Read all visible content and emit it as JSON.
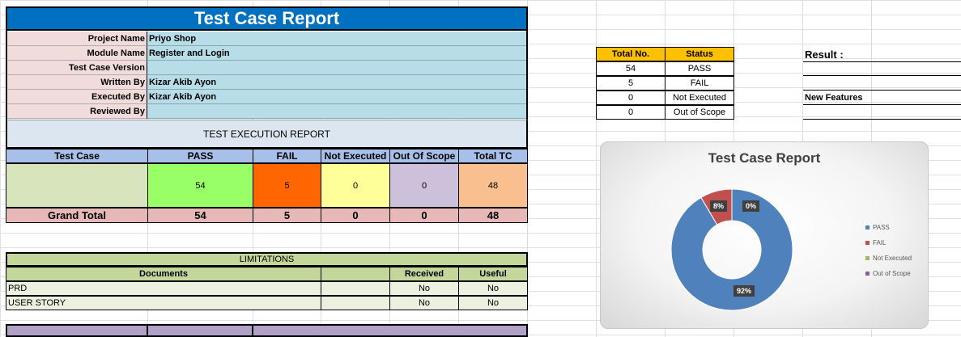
{
  "report": {
    "title": "Test Case Report",
    "fields": [
      {
        "label": "Project Name",
        "value": "Priyo Shop"
      },
      {
        "label": "Module Name",
        "value": "Register and Login"
      },
      {
        "label": "Test Case Version",
        "value": ""
      },
      {
        "label": "Written By",
        "value": "Kizar Akib Ayon"
      },
      {
        "label": "Executed By",
        "value": "Kizar Akib Ayon"
      },
      {
        "label": "Reviewed By",
        "value": ""
      }
    ],
    "execution_title": "TEST EXECUTION REPORT",
    "columns": [
      "Test Case",
      "PASS",
      "FAIL",
      "Not Executed",
      "Out Of Scope",
      "Total TC"
    ],
    "row_values": [
      "",
      "54",
      "5",
      "0",
      "0",
      "48"
    ],
    "grand_total_label": "Grand Total",
    "grand_total_values": [
      "54",
      "5",
      "0",
      "0",
      "48"
    ]
  },
  "limitations": {
    "title": "LIMITATIONS",
    "headers": [
      "Documents",
      "Received",
      "Useful"
    ],
    "rows": [
      {
        "document": "PRD",
        "received": "No",
        "useful": "No"
      },
      {
        "document": "USER STORY",
        "received": "No",
        "useful": "No"
      }
    ]
  },
  "summary": {
    "headers": [
      "Total No.",
      "Status"
    ],
    "rows": [
      {
        "total": "54",
        "status": "PASS"
      },
      {
        "total": "5",
        "status": "FAIL"
      },
      {
        "total": "0",
        "status": "Not Executed"
      },
      {
        "total": "0",
        "status": "Out of Scope"
      }
    ],
    "result_label": "Result :",
    "new_features_label": "New Features"
  },
  "colors": {
    "title_blue": "#0070c0",
    "pass_green": "#99ff66",
    "fail_orange": "#ff6600",
    "not_executed_yellow": "#ffff99",
    "out_of_scope_purple": "#ccc0da",
    "total_peach": "#fabf8f",
    "header_gold": "#ffc000"
  },
  "chart_data": {
    "type": "pie",
    "title": "Test Case Report",
    "donut": true,
    "labels": [
      "PASS",
      "FAIL",
      "Not Executed",
      "Out of Scope"
    ],
    "values": [
      54,
      5,
      0,
      0
    ],
    "data_labels": [
      "92%",
      "8%",
      "0%",
      ""
    ],
    "colors": [
      "#4f81bd",
      "#c0504d",
      "#9bbb59",
      "#8064a2"
    ],
    "legend": "right"
  }
}
